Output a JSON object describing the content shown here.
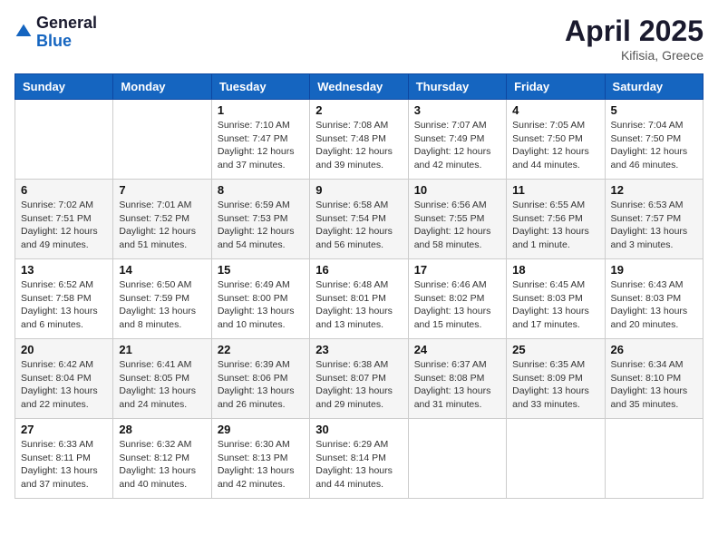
{
  "header": {
    "logo_general": "General",
    "logo_blue": "Blue",
    "month_title": "April 2025",
    "location": "Kifisia, Greece"
  },
  "columns": [
    "Sunday",
    "Monday",
    "Tuesday",
    "Wednesday",
    "Thursday",
    "Friday",
    "Saturday"
  ],
  "weeks": [
    [
      {
        "day": "",
        "sunrise": "",
        "sunset": "",
        "daylight": ""
      },
      {
        "day": "",
        "sunrise": "",
        "sunset": "",
        "daylight": ""
      },
      {
        "day": "1",
        "sunrise": "Sunrise: 7:10 AM",
        "sunset": "Sunset: 7:47 PM",
        "daylight": "Daylight: 12 hours and 37 minutes."
      },
      {
        "day": "2",
        "sunrise": "Sunrise: 7:08 AM",
        "sunset": "Sunset: 7:48 PM",
        "daylight": "Daylight: 12 hours and 39 minutes."
      },
      {
        "day": "3",
        "sunrise": "Sunrise: 7:07 AM",
        "sunset": "Sunset: 7:49 PM",
        "daylight": "Daylight: 12 hours and 42 minutes."
      },
      {
        "day": "4",
        "sunrise": "Sunrise: 7:05 AM",
        "sunset": "Sunset: 7:50 PM",
        "daylight": "Daylight: 12 hours and 44 minutes."
      },
      {
        "day": "5",
        "sunrise": "Sunrise: 7:04 AM",
        "sunset": "Sunset: 7:50 PM",
        "daylight": "Daylight: 12 hours and 46 minutes."
      }
    ],
    [
      {
        "day": "6",
        "sunrise": "Sunrise: 7:02 AM",
        "sunset": "Sunset: 7:51 PM",
        "daylight": "Daylight: 12 hours and 49 minutes."
      },
      {
        "day": "7",
        "sunrise": "Sunrise: 7:01 AM",
        "sunset": "Sunset: 7:52 PM",
        "daylight": "Daylight: 12 hours and 51 minutes."
      },
      {
        "day": "8",
        "sunrise": "Sunrise: 6:59 AM",
        "sunset": "Sunset: 7:53 PM",
        "daylight": "Daylight: 12 hours and 54 minutes."
      },
      {
        "day": "9",
        "sunrise": "Sunrise: 6:58 AM",
        "sunset": "Sunset: 7:54 PM",
        "daylight": "Daylight: 12 hours and 56 minutes."
      },
      {
        "day": "10",
        "sunrise": "Sunrise: 6:56 AM",
        "sunset": "Sunset: 7:55 PM",
        "daylight": "Daylight: 12 hours and 58 minutes."
      },
      {
        "day": "11",
        "sunrise": "Sunrise: 6:55 AM",
        "sunset": "Sunset: 7:56 PM",
        "daylight": "Daylight: 13 hours and 1 minute."
      },
      {
        "day": "12",
        "sunrise": "Sunrise: 6:53 AM",
        "sunset": "Sunset: 7:57 PM",
        "daylight": "Daylight: 13 hours and 3 minutes."
      }
    ],
    [
      {
        "day": "13",
        "sunrise": "Sunrise: 6:52 AM",
        "sunset": "Sunset: 7:58 PM",
        "daylight": "Daylight: 13 hours and 6 minutes."
      },
      {
        "day": "14",
        "sunrise": "Sunrise: 6:50 AM",
        "sunset": "Sunset: 7:59 PM",
        "daylight": "Daylight: 13 hours and 8 minutes."
      },
      {
        "day": "15",
        "sunrise": "Sunrise: 6:49 AM",
        "sunset": "Sunset: 8:00 PM",
        "daylight": "Daylight: 13 hours and 10 minutes."
      },
      {
        "day": "16",
        "sunrise": "Sunrise: 6:48 AM",
        "sunset": "Sunset: 8:01 PM",
        "daylight": "Daylight: 13 hours and 13 minutes."
      },
      {
        "day": "17",
        "sunrise": "Sunrise: 6:46 AM",
        "sunset": "Sunset: 8:02 PM",
        "daylight": "Daylight: 13 hours and 15 minutes."
      },
      {
        "day": "18",
        "sunrise": "Sunrise: 6:45 AM",
        "sunset": "Sunset: 8:03 PM",
        "daylight": "Daylight: 13 hours and 17 minutes."
      },
      {
        "day": "19",
        "sunrise": "Sunrise: 6:43 AM",
        "sunset": "Sunset: 8:03 PM",
        "daylight": "Daylight: 13 hours and 20 minutes."
      }
    ],
    [
      {
        "day": "20",
        "sunrise": "Sunrise: 6:42 AM",
        "sunset": "Sunset: 8:04 PM",
        "daylight": "Daylight: 13 hours and 22 minutes."
      },
      {
        "day": "21",
        "sunrise": "Sunrise: 6:41 AM",
        "sunset": "Sunset: 8:05 PM",
        "daylight": "Daylight: 13 hours and 24 minutes."
      },
      {
        "day": "22",
        "sunrise": "Sunrise: 6:39 AM",
        "sunset": "Sunset: 8:06 PM",
        "daylight": "Daylight: 13 hours and 26 minutes."
      },
      {
        "day": "23",
        "sunrise": "Sunrise: 6:38 AM",
        "sunset": "Sunset: 8:07 PM",
        "daylight": "Daylight: 13 hours and 29 minutes."
      },
      {
        "day": "24",
        "sunrise": "Sunrise: 6:37 AM",
        "sunset": "Sunset: 8:08 PM",
        "daylight": "Daylight: 13 hours and 31 minutes."
      },
      {
        "day": "25",
        "sunrise": "Sunrise: 6:35 AM",
        "sunset": "Sunset: 8:09 PM",
        "daylight": "Daylight: 13 hours and 33 minutes."
      },
      {
        "day": "26",
        "sunrise": "Sunrise: 6:34 AM",
        "sunset": "Sunset: 8:10 PM",
        "daylight": "Daylight: 13 hours and 35 minutes."
      }
    ],
    [
      {
        "day": "27",
        "sunrise": "Sunrise: 6:33 AM",
        "sunset": "Sunset: 8:11 PM",
        "daylight": "Daylight: 13 hours and 37 minutes."
      },
      {
        "day": "28",
        "sunrise": "Sunrise: 6:32 AM",
        "sunset": "Sunset: 8:12 PM",
        "daylight": "Daylight: 13 hours and 40 minutes."
      },
      {
        "day": "29",
        "sunrise": "Sunrise: 6:30 AM",
        "sunset": "Sunset: 8:13 PM",
        "daylight": "Daylight: 13 hours and 42 minutes."
      },
      {
        "day": "30",
        "sunrise": "Sunrise: 6:29 AM",
        "sunset": "Sunset: 8:14 PM",
        "daylight": "Daylight: 13 hours and 44 minutes."
      },
      {
        "day": "",
        "sunrise": "",
        "sunset": "",
        "daylight": ""
      },
      {
        "day": "",
        "sunrise": "",
        "sunset": "",
        "daylight": ""
      },
      {
        "day": "",
        "sunrise": "",
        "sunset": "",
        "daylight": ""
      }
    ]
  ]
}
